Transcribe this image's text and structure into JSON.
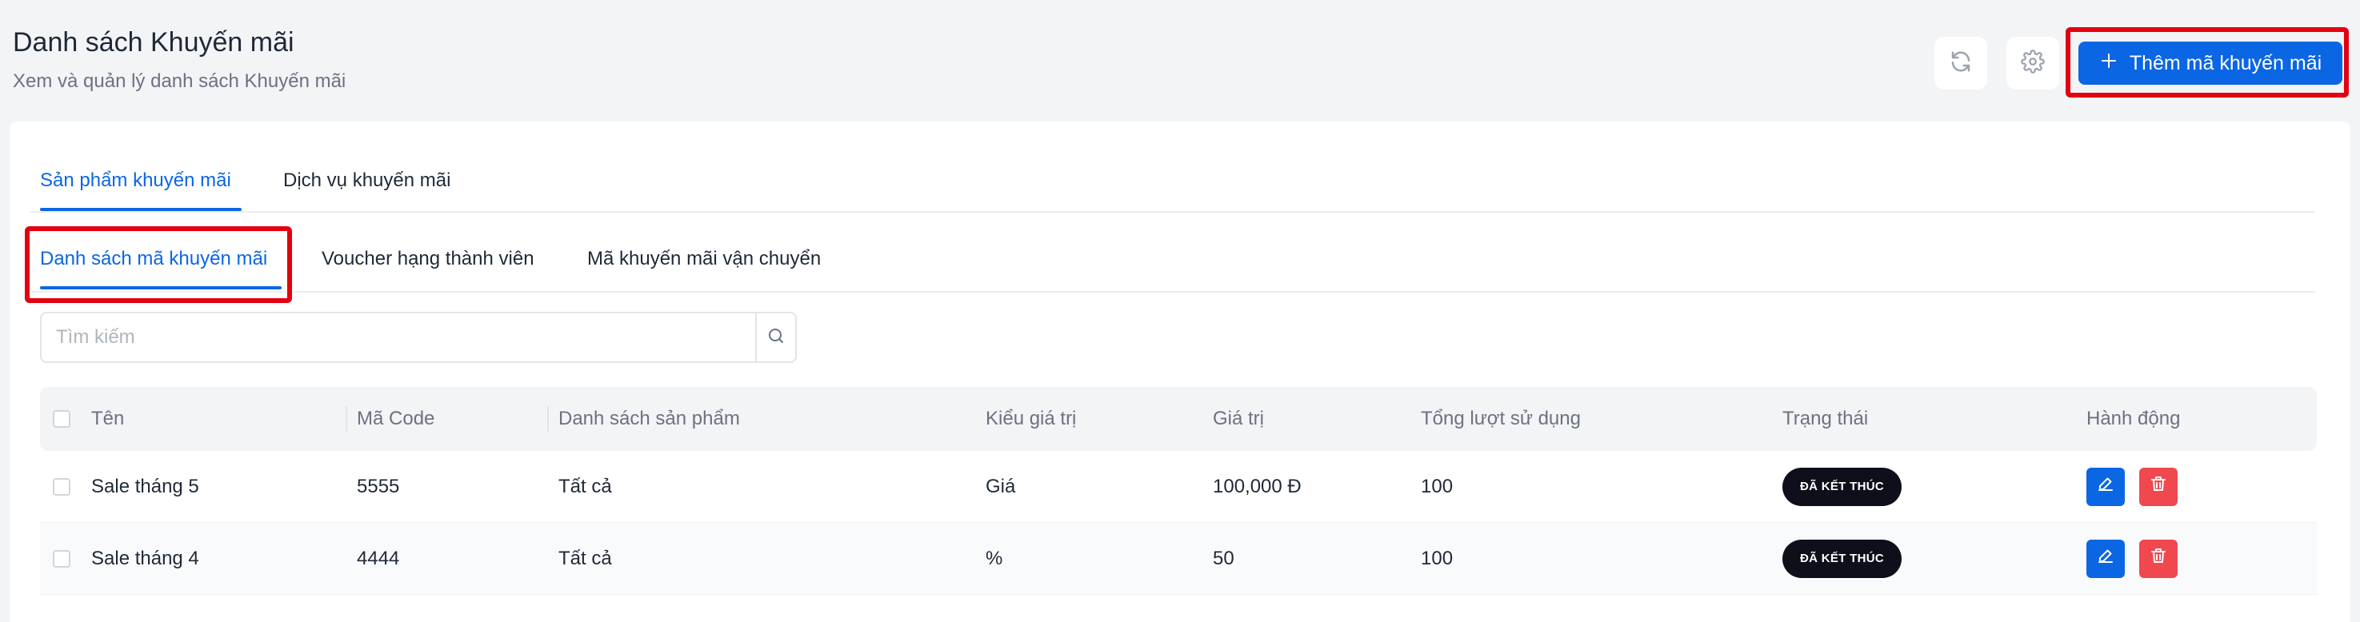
{
  "header": {
    "title": "Danh sách Khuyến mãi",
    "subtitle": "Xem và quản lý danh sách Khuyến mãi",
    "add_button_label": "Thêm mã khuyến mãi",
    "refresh_icon": "refresh-icon",
    "settings_icon": "gear-icon"
  },
  "tabs": [
    {
      "label": "Sản phẩm khuyến mãi",
      "active": true
    },
    {
      "label": "Dịch vụ khuyến mãi",
      "active": false
    }
  ],
  "subtabs": [
    {
      "label": "Danh sách mã khuyến mãi",
      "active": true
    },
    {
      "label": "Voucher hạng thành viên",
      "active": false
    },
    {
      "label": "Mã khuyến mãi vận chuyển",
      "active": false
    }
  ],
  "search": {
    "placeholder": "Tìm kiếm",
    "value": ""
  },
  "table": {
    "columns": [
      "Tên",
      "Mã Code",
      "Danh sách sản phẩm",
      "Kiểu giá trị",
      "Giá trị",
      "Tổng lượt sử dụng",
      "Trạng thái",
      "Hành động"
    ],
    "rows": [
      {
        "name": "Sale tháng 5",
        "code": "5555",
        "products": "Tất cả",
        "value_type": "Giá",
        "value": "100,000 Đ",
        "total_usage": "100",
        "status": "ĐÃ KẾT THÚC"
      },
      {
        "name": "Sale tháng 4",
        "code": "4444",
        "products": "Tất cả",
        "value_type": "%",
        "value": "50",
        "total_usage": "100",
        "status": "ĐÃ KẾT THÚC"
      }
    ]
  },
  "colors": {
    "primary": "#0b66e4",
    "danger": "#f0484f",
    "highlight": "#e3000f",
    "badge": "#0e0f1a"
  }
}
